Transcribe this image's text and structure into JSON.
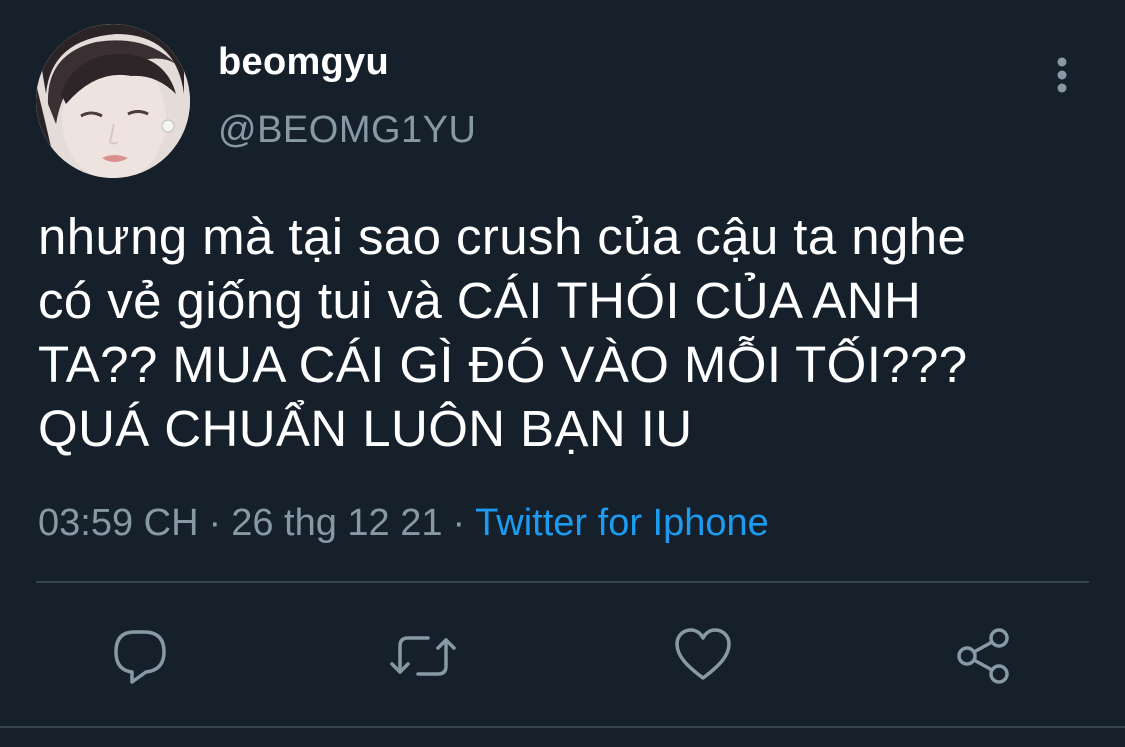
{
  "user": {
    "display_name": "beomgyu",
    "handle": "@BEOMG1YU",
    "avatar_icon": "profile-photo"
  },
  "tweet": {
    "lines": [
      "nhưng mà tại sao crush của cậu ta nghe",
      "có vẻ giống tui và CÁI THÓI CỦA ANH",
      "TA?? MUA CÁI GÌ ĐÓ VÀO MỖI TỐI???",
      "QUÁ CHUẨN LUÔN BẠN IU"
    ]
  },
  "meta": {
    "time": "03:59 CH",
    "separator": "·",
    "date": "26 thg 12 21",
    "source": "Twitter for Iphone"
  },
  "actions": [
    {
      "icon": "reply-icon"
    },
    {
      "icon": "retweet-icon"
    },
    {
      "icon": "like-icon"
    },
    {
      "icon": "share-icon"
    }
  ],
  "colors": {
    "background": "#15202b",
    "text": "#ffffff",
    "secondary_text": "#8899a6",
    "link": "#1d9bf0",
    "divider": "#38444d"
  }
}
